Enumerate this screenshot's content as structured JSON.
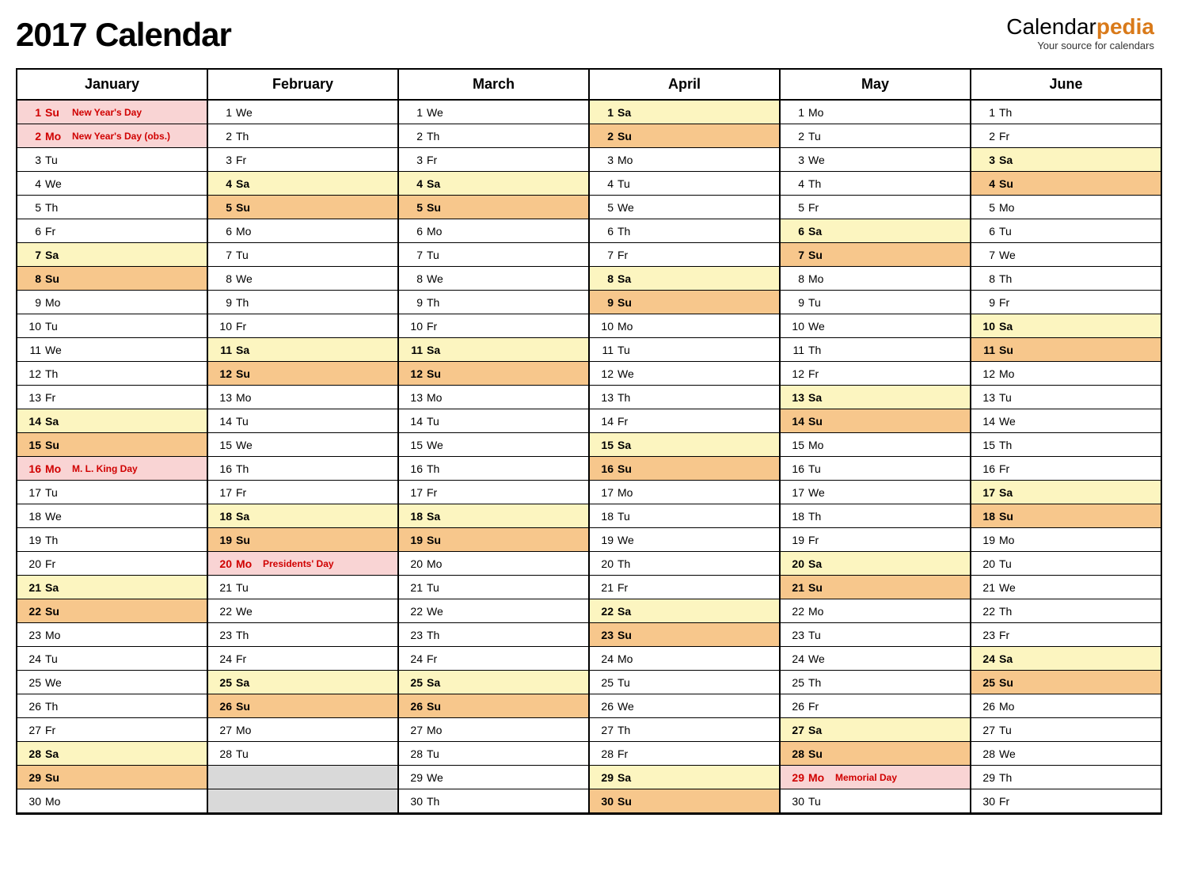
{
  "title": "2017 Calendar",
  "logo": {
    "brand_a": "Calendar",
    "brand_b": "pedia",
    "tagline": "Your source for calendars"
  },
  "months": [
    {
      "name": "January",
      "days": [
        {
          "n": 1,
          "d": "Su",
          "t": "holiday",
          "e": "New Year's Day"
        },
        {
          "n": 2,
          "d": "Mo",
          "t": "holiday",
          "e": "New Year's Day (obs.)"
        },
        {
          "n": 3,
          "d": "Tu",
          "t": ""
        },
        {
          "n": 4,
          "d": "We",
          "t": ""
        },
        {
          "n": 5,
          "d": "Th",
          "t": ""
        },
        {
          "n": 6,
          "d": "Fr",
          "t": ""
        },
        {
          "n": 7,
          "d": "Sa",
          "t": "sat"
        },
        {
          "n": 8,
          "d": "Su",
          "t": "sun"
        },
        {
          "n": 9,
          "d": "Mo",
          "t": ""
        },
        {
          "n": 10,
          "d": "Tu",
          "t": ""
        },
        {
          "n": 11,
          "d": "We",
          "t": ""
        },
        {
          "n": 12,
          "d": "Th",
          "t": ""
        },
        {
          "n": 13,
          "d": "Fr",
          "t": ""
        },
        {
          "n": 14,
          "d": "Sa",
          "t": "sat"
        },
        {
          "n": 15,
          "d": "Su",
          "t": "sun"
        },
        {
          "n": 16,
          "d": "Mo",
          "t": "holiday",
          "e": "M. L. King Day"
        },
        {
          "n": 17,
          "d": "Tu",
          "t": ""
        },
        {
          "n": 18,
          "d": "We",
          "t": ""
        },
        {
          "n": 19,
          "d": "Th",
          "t": ""
        },
        {
          "n": 20,
          "d": "Fr",
          "t": ""
        },
        {
          "n": 21,
          "d": "Sa",
          "t": "sat"
        },
        {
          "n": 22,
          "d": "Su",
          "t": "sun"
        },
        {
          "n": 23,
          "d": "Mo",
          "t": ""
        },
        {
          "n": 24,
          "d": "Tu",
          "t": ""
        },
        {
          "n": 25,
          "d": "We",
          "t": ""
        },
        {
          "n": 26,
          "d": "Th",
          "t": ""
        },
        {
          "n": 27,
          "d": "Fr",
          "t": ""
        },
        {
          "n": 28,
          "d": "Sa",
          "t": "sat"
        },
        {
          "n": 29,
          "d": "Su",
          "t": "sun"
        },
        {
          "n": 30,
          "d": "Mo",
          "t": ""
        }
      ]
    },
    {
      "name": "February",
      "days": [
        {
          "n": 1,
          "d": "We",
          "t": ""
        },
        {
          "n": 2,
          "d": "Th",
          "t": ""
        },
        {
          "n": 3,
          "d": "Fr",
          "t": ""
        },
        {
          "n": 4,
          "d": "Sa",
          "t": "sat"
        },
        {
          "n": 5,
          "d": "Su",
          "t": "sun"
        },
        {
          "n": 6,
          "d": "Mo",
          "t": ""
        },
        {
          "n": 7,
          "d": "Tu",
          "t": ""
        },
        {
          "n": 8,
          "d": "We",
          "t": ""
        },
        {
          "n": 9,
          "d": "Th",
          "t": ""
        },
        {
          "n": 10,
          "d": "Fr",
          "t": ""
        },
        {
          "n": 11,
          "d": "Sa",
          "t": "sat"
        },
        {
          "n": 12,
          "d": "Su",
          "t": "sun"
        },
        {
          "n": 13,
          "d": "Mo",
          "t": ""
        },
        {
          "n": 14,
          "d": "Tu",
          "t": ""
        },
        {
          "n": 15,
          "d": "We",
          "t": ""
        },
        {
          "n": 16,
          "d": "Th",
          "t": ""
        },
        {
          "n": 17,
          "d": "Fr",
          "t": ""
        },
        {
          "n": 18,
          "d": "Sa",
          "t": "sat"
        },
        {
          "n": 19,
          "d": "Su",
          "t": "sun"
        },
        {
          "n": 20,
          "d": "Mo",
          "t": "holiday",
          "e": "Presidents' Day"
        },
        {
          "n": 21,
          "d": "Tu",
          "t": ""
        },
        {
          "n": 22,
          "d": "We",
          "t": ""
        },
        {
          "n": 23,
          "d": "Th",
          "t": ""
        },
        {
          "n": 24,
          "d": "Fr",
          "t": ""
        },
        {
          "n": 25,
          "d": "Sa",
          "t": "sat"
        },
        {
          "n": 26,
          "d": "Su",
          "t": "sun"
        },
        {
          "n": 27,
          "d": "Mo",
          "t": ""
        },
        {
          "n": 28,
          "d": "Tu",
          "t": ""
        },
        {
          "n": "",
          "d": "",
          "t": "empty"
        },
        {
          "n": "",
          "d": "",
          "t": "empty"
        }
      ]
    },
    {
      "name": "March",
      "days": [
        {
          "n": 1,
          "d": "We",
          "t": ""
        },
        {
          "n": 2,
          "d": "Th",
          "t": ""
        },
        {
          "n": 3,
          "d": "Fr",
          "t": ""
        },
        {
          "n": 4,
          "d": "Sa",
          "t": "sat"
        },
        {
          "n": 5,
          "d": "Su",
          "t": "sun"
        },
        {
          "n": 6,
          "d": "Mo",
          "t": ""
        },
        {
          "n": 7,
          "d": "Tu",
          "t": ""
        },
        {
          "n": 8,
          "d": "We",
          "t": ""
        },
        {
          "n": 9,
          "d": "Th",
          "t": ""
        },
        {
          "n": 10,
          "d": "Fr",
          "t": ""
        },
        {
          "n": 11,
          "d": "Sa",
          "t": "sat"
        },
        {
          "n": 12,
          "d": "Su",
          "t": "sun"
        },
        {
          "n": 13,
          "d": "Mo",
          "t": ""
        },
        {
          "n": 14,
          "d": "Tu",
          "t": ""
        },
        {
          "n": 15,
          "d": "We",
          "t": ""
        },
        {
          "n": 16,
          "d": "Th",
          "t": ""
        },
        {
          "n": 17,
          "d": "Fr",
          "t": ""
        },
        {
          "n": 18,
          "d": "Sa",
          "t": "sat"
        },
        {
          "n": 19,
          "d": "Su",
          "t": "sun"
        },
        {
          "n": 20,
          "d": "Mo",
          "t": ""
        },
        {
          "n": 21,
          "d": "Tu",
          "t": ""
        },
        {
          "n": 22,
          "d": "We",
          "t": ""
        },
        {
          "n": 23,
          "d": "Th",
          "t": ""
        },
        {
          "n": 24,
          "d": "Fr",
          "t": ""
        },
        {
          "n": 25,
          "d": "Sa",
          "t": "sat"
        },
        {
          "n": 26,
          "d": "Su",
          "t": "sun"
        },
        {
          "n": 27,
          "d": "Mo",
          "t": ""
        },
        {
          "n": 28,
          "d": "Tu",
          "t": ""
        },
        {
          "n": 29,
          "d": "We",
          "t": ""
        },
        {
          "n": 30,
          "d": "Th",
          "t": ""
        }
      ]
    },
    {
      "name": "April",
      "days": [
        {
          "n": 1,
          "d": "Sa",
          "t": "sat"
        },
        {
          "n": 2,
          "d": "Su",
          "t": "sun"
        },
        {
          "n": 3,
          "d": "Mo",
          "t": ""
        },
        {
          "n": 4,
          "d": "Tu",
          "t": ""
        },
        {
          "n": 5,
          "d": "We",
          "t": ""
        },
        {
          "n": 6,
          "d": "Th",
          "t": ""
        },
        {
          "n": 7,
          "d": "Fr",
          "t": ""
        },
        {
          "n": 8,
          "d": "Sa",
          "t": "sat"
        },
        {
          "n": 9,
          "d": "Su",
          "t": "sun"
        },
        {
          "n": 10,
          "d": "Mo",
          "t": ""
        },
        {
          "n": 11,
          "d": "Tu",
          "t": ""
        },
        {
          "n": 12,
          "d": "We",
          "t": ""
        },
        {
          "n": 13,
          "d": "Th",
          "t": ""
        },
        {
          "n": 14,
          "d": "Fr",
          "t": ""
        },
        {
          "n": 15,
          "d": "Sa",
          "t": "sat"
        },
        {
          "n": 16,
          "d": "Su",
          "t": "sun"
        },
        {
          "n": 17,
          "d": "Mo",
          "t": ""
        },
        {
          "n": 18,
          "d": "Tu",
          "t": ""
        },
        {
          "n": 19,
          "d": "We",
          "t": ""
        },
        {
          "n": 20,
          "d": "Th",
          "t": ""
        },
        {
          "n": 21,
          "d": "Fr",
          "t": ""
        },
        {
          "n": 22,
          "d": "Sa",
          "t": "sat"
        },
        {
          "n": 23,
          "d": "Su",
          "t": "sun"
        },
        {
          "n": 24,
          "d": "Mo",
          "t": ""
        },
        {
          "n": 25,
          "d": "Tu",
          "t": ""
        },
        {
          "n": 26,
          "d": "We",
          "t": ""
        },
        {
          "n": 27,
          "d": "Th",
          "t": ""
        },
        {
          "n": 28,
          "d": "Fr",
          "t": ""
        },
        {
          "n": 29,
          "d": "Sa",
          "t": "sat"
        },
        {
          "n": 30,
          "d": "Su",
          "t": "sun"
        }
      ]
    },
    {
      "name": "May",
      "days": [
        {
          "n": 1,
          "d": "Mo",
          "t": ""
        },
        {
          "n": 2,
          "d": "Tu",
          "t": ""
        },
        {
          "n": 3,
          "d": "We",
          "t": ""
        },
        {
          "n": 4,
          "d": "Th",
          "t": ""
        },
        {
          "n": 5,
          "d": "Fr",
          "t": ""
        },
        {
          "n": 6,
          "d": "Sa",
          "t": "sat"
        },
        {
          "n": 7,
          "d": "Su",
          "t": "sun"
        },
        {
          "n": 8,
          "d": "Mo",
          "t": ""
        },
        {
          "n": 9,
          "d": "Tu",
          "t": ""
        },
        {
          "n": 10,
          "d": "We",
          "t": ""
        },
        {
          "n": 11,
          "d": "Th",
          "t": ""
        },
        {
          "n": 12,
          "d": "Fr",
          "t": ""
        },
        {
          "n": 13,
          "d": "Sa",
          "t": "sat"
        },
        {
          "n": 14,
          "d": "Su",
          "t": "sun"
        },
        {
          "n": 15,
          "d": "Mo",
          "t": ""
        },
        {
          "n": 16,
          "d": "Tu",
          "t": ""
        },
        {
          "n": 17,
          "d": "We",
          "t": ""
        },
        {
          "n": 18,
          "d": "Th",
          "t": ""
        },
        {
          "n": 19,
          "d": "Fr",
          "t": ""
        },
        {
          "n": 20,
          "d": "Sa",
          "t": "sat"
        },
        {
          "n": 21,
          "d": "Su",
          "t": "sun"
        },
        {
          "n": 22,
          "d": "Mo",
          "t": ""
        },
        {
          "n": 23,
          "d": "Tu",
          "t": ""
        },
        {
          "n": 24,
          "d": "We",
          "t": ""
        },
        {
          "n": 25,
          "d": "Th",
          "t": ""
        },
        {
          "n": 26,
          "d": "Fr",
          "t": ""
        },
        {
          "n": 27,
          "d": "Sa",
          "t": "sat"
        },
        {
          "n": 28,
          "d": "Su",
          "t": "sun"
        },
        {
          "n": 29,
          "d": "Mo",
          "t": "holiday",
          "e": "Memorial Day"
        },
        {
          "n": 30,
          "d": "Tu",
          "t": ""
        }
      ]
    },
    {
      "name": "June",
      "days": [
        {
          "n": 1,
          "d": "Th",
          "t": ""
        },
        {
          "n": 2,
          "d": "Fr",
          "t": ""
        },
        {
          "n": 3,
          "d": "Sa",
          "t": "sat"
        },
        {
          "n": 4,
          "d": "Su",
          "t": "sun"
        },
        {
          "n": 5,
          "d": "Mo",
          "t": ""
        },
        {
          "n": 6,
          "d": "Tu",
          "t": ""
        },
        {
          "n": 7,
          "d": "We",
          "t": ""
        },
        {
          "n": 8,
          "d": "Th",
          "t": ""
        },
        {
          "n": 9,
          "d": "Fr",
          "t": ""
        },
        {
          "n": 10,
          "d": "Sa",
          "t": "sat"
        },
        {
          "n": 11,
          "d": "Su",
          "t": "sun"
        },
        {
          "n": 12,
          "d": "Mo",
          "t": ""
        },
        {
          "n": 13,
          "d": "Tu",
          "t": ""
        },
        {
          "n": 14,
          "d": "We",
          "t": ""
        },
        {
          "n": 15,
          "d": "Th",
          "t": ""
        },
        {
          "n": 16,
          "d": "Fr",
          "t": ""
        },
        {
          "n": 17,
          "d": "Sa",
          "t": "sat"
        },
        {
          "n": 18,
          "d": "Su",
          "t": "sun"
        },
        {
          "n": 19,
          "d": "Mo",
          "t": ""
        },
        {
          "n": 20,
          "d": "Tu",
          "t": ""
        },
        {
          "n": 21,
          "d": "We",
          "t": ""
        },
        {
          "n": 22,
          "d": "Th",
          "t": ""
        },
        {
          "n": 23,
          "d": "Fr",
          "t": ""
        },
        {
          "n": 24,
          "d": "Sa",
          "t": "sat"
        },
        {
          "n": 25,
          "d": "Su",
          "t": "sun"
        },
        {
          "n": 26,
          "d": "Mo",
          "t": ""
        },
        {
          "n": 27,
          "d": "Tu",
          "t": ""
        },
        {
          "n": 28,
          "d": "We",
          "t": ""
        },
        {
          "n": 29,
          "d": "Th",
          "t": ""
        },
        {
          "n": 30,
          "d": "Fr",
          "t": ""
        }
      ]
    }
  ]
}
